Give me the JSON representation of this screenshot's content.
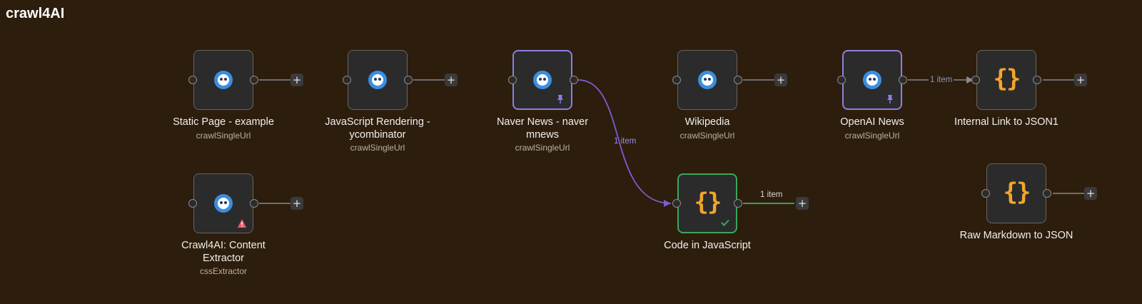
{
  "workflow": {
    "title": "crawl4AI"
  },
  "nodes": {
    "static_page": {
      "label": "Static Page - example",
      "subtitle": "crawlSingleUrl"
    },
    "js_rendering": {
      "label": "JavaScript Rendering - ycombinator",
      "subtitle": "crawlSingleUrl"
    },
    "naver_news": {
      "label": "Naver News - naver mnews",
      "subtitle": "crawlSingleUrl",
      "status": "pinned"
    },
    "wikipedia": {
      "label": "Wikipedia",
      "subtitle": "crawlSingleUrl"
    },
    "openai_news": {
      "label": "OpenAI News",
      "subtitle": "crawlSingleUrl",
      "status": "pinned"
    },
    "internal_link": {
      "label": "Internal Link to JSON1",
      "icon": "code-braces-icon"
    },
    "content_extractor": {
      "label": "Crawl4AI: Content Extractor",
      "subtitle": "cssExtractor",
      "status": "warning"
    },
    "code_js": {
      "label": "Code in JavaScript",
      "icon": "code-braces-icon",
      "status": "success"
    },
    "raw_markdown": {
      "label": "Raw Markdown to JSON",
      "icon": "code-braces-icon"
    }
  },
  "edges": {
    "naver_to_code": {
      "label": "1 item",
      "color": "#7e5bd6"
    },
    "code_out": {
      "label": "1 item",
      "color": "#3fae5b"
    },
    "openai_to_internal": {
      "label": "1 item",
      "color": "#8a8a8a"
    }
  },
  "icons": {
    "brace_text": "{}",
    "add": "+"
  },
  "colors": {
    "background": "#2d1d0c",
    "node_bg": "#2b2b2c",
    "pinned": "#8e7fe0",
    "success": "#38a85a",
    "warning": "#ef5b6b",
    "code_icon": "#f4a52a",
    "crawl_icon": "#3b8ee0"
  }
}
